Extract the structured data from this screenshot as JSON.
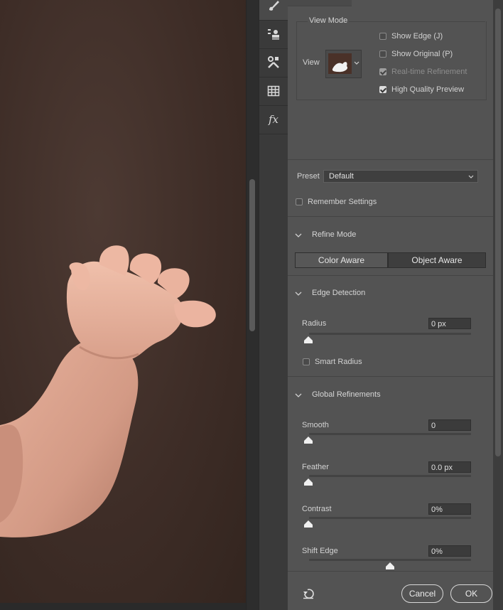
{
  "view_mode": {
    "title": "View Mode",
    "view_label": "View",
    "options": [
      {
        "label": "Show Edge (J)",
        "checked": false,
        "disabled": false
      },
      {
        "label": "Show Original (P)",
        "checked": false,
        "disabled": false
      },
      {
        "label": "Real-time Refinement",
        "checked": true,
        "disabled": true
      },
      {
        "label": "High Quality Preview",
        "checked": true,
        "disabled": false
      }
    ]
  },
  "preset": {
    "label": "Preset",
    "value": "Default"
  },
  "remember_settings": {
    "label": "Remember Settings",
    "checked": false
  },
  "refine_mode": {
    "title": "Refine Mode",
    "options": [
      "Color Aware",
      "Object Aware"
    ],
    "selected": "Object Aware"
  },
  "edge_detection": {
    "title": "Edge Detection",
    "radius": {
      "label": "Radius",
      "value": "0 px",
      "level": 0
    },
    "smart_radius": {
      "label": "Smart Radius",
      "checked": false
    }
  },
  "global_refinements": {
    "title": "Global Refinements",
    "sliders": [
      {
        "label": "Smooth",
        "value": "0",
        "level": 0
      },
      {
        "label": "Feather",
        "value": "0.0 px",
        "level": 0
      },
      {
        "label": "Contrast",
        "value": "0%",
        "level": 0
      },
      {
        "label": "Shift Edge",
        "value": "0%",
        "level": 0.5
      }
    ]
  },
  "footer": {
    "cancel": "Cancel",
    "ok": "OK"
  },
  "tools": [
    "brush-icon",
    "stamp-list-icon",
    "tools-icon",
    "grid-icon",
    "fx-icon"
  ],
  "colors": {
    "panel": "#535353",
    "canvas_bg": "#3e2d27",
    "skin": "#e0a58f"
  }
}
